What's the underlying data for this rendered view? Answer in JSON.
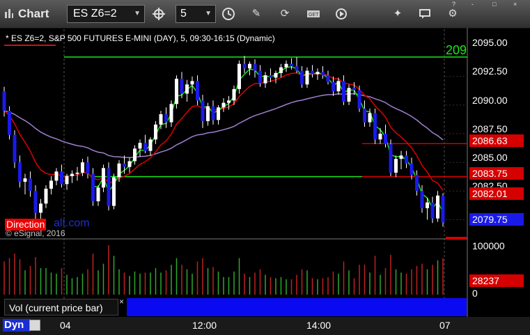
{
  "toolbar": {
    "app_title": "Chart",
    "symbol": "ES Z6=2",
    "interval": "5",
    "window_buttons": [
      "?",
      "-",
      "□",
      "×"
    ],
    "icons": [
      "crosshair-icon",
      "clock-icon",
      "pencil-icon",
      "refresh-icon",
      "get-icon",
      "play-icon",
      "tools-icon",
      "chat-icon",
      "gear-icon"
    ]
  },
  "chart_header": {
    "subtitle": "* ES Z6=2, S&P 500 FUTURES E-MINI (DAY), 5, 09:30-16:15 (Dynamic)",
    "brand_red": "Direction",
    "brand_blue": "alt.com",
    "copyright": "© eSignal, 2016",
    "edge_label": "209"
  },
  "price_axis": {
    "labels": [
      "2095.00",
      "2092.50",
      "2090.00",
      "2087.50",
      "2085.00",
      "2082.50"
    ],
    "tags": [
      {
        "value": "2086.63",
        "color": "#d50000"
      },
      {
        "value": "2083.75",
        "color": "#d50000"
      },
      {
        "value": "2082.01",
        "color": "#d50000"
      },
      {
        "value": "2079.75",
        "color": "#1a1ae8"
      }
    ]
  },
  "volume_axis": {
    "labels": [
      "100000",
      "0"
    ],
    "tag": "28237",
    "tag_color": "#d50000"
  },
  "footer": {
    "dyn": "Dyn",
    "x_ticks": [
      "04",
      "12:00",
      "14:00",
      "07"
    ],
    "vol_label": "Vol (current price bar)",
    "vol_close": "×"
  },
  "chart_data": {
    "type": "candlestick",
    "ylim": [
      2078.5,
      2096.5
    ],
    "horizontal_levels": [
      {
        "value": 2094.2,
        "color": "#19e619"
      },
      {
        "value": 2086.63,
        "color": "#d50000"
      },
      {
        "value": 2083.75,
        "color": "#d50000"
      }
    ],
    "candles": [
      [
        2091.2,
        2091.6,
        2089.0,
        2089.5
      ],
      [
        2089.5,
        2089.9,
        2087.0,
        2087.4
      ],
      [
        2087.4,
        2087.8,
        2084.5,
        2085.0
      ],
      [
        2085.0,
        2085.6,
        2082.8,
        2083.3
      ],
      [
        2083.3,
        2084.0,
        2082.2,
        2083.6
      ],
      [
        2083.6,
        2084.2,
        2082.0,
        2082.5
      ],
      [
        2082.5,
        2083.0,
        2080.0,
        2080.6
      ],
      [
        2080.6,
        2081.8,
        2079.8,
        2081.4
      ],
      [
        2081.4,
        2083.0,
        2081.0,
        2082.7
      ],
      [
        2082.7,
        2083.8,
        2082.2,
        2083.4
      ],
      [
        2083.4,
        2084.5,
        2083.0,
        2084.2
      ],
      [
        2084.2,
        2084.8,
        2082.8,
        2083.1
      ],
      [
        2083.1,
        2084.0,
        2082.6,
        2083.8
      ],
      [
        2083.8,
        2084.3,
        2083.2,
        2084.0
      ],
      [
        2084.0,
        2084.6,
        2083.4,
        2084.1
      ],
      [
        2084.1,
        2085.3,
        2083.8,
        2085.0
      ],
      [
        2085.0,
        2085.5,
        2083.6,
        2084.0
      ],
      [
        2084.0,
        2084.5,
        2081.2,
        2081.6
      ],
      [
        2081.6,
        2083.0,
        2081.2,
        2082.8
      ],
      [
        2082.8,
        2084.8,
        2082.4,
        2084.5
      ],
      [
        2084.5,
        2085.0,
        2080.8,
        2081.2
      ],
      [
        2081.2,
        2084.0,
        2080.9,
        2083.7
      ],
      [
        2083.7,
        2085.2,
        2083.3,
        2084.9
      ],
      [
        2084.9,
        2085.6,
        2084.0,
        2084.6
      ],
      [
        2084.6,
        2085.4,
        2084.1,
        2085.1
      ],
      [
        2085.1,
        2086.5,
        2084.8,
        2086.2
      ],
      [
        2086.2,
        2087.0,
        2085.5,
        2086.7
      ],
      [
        2086.7,
        2087.4,
        2085.8,
        2086.0
      ],
      [
        2086.0,
        2087.2,
        2085.6,
        2087.0
      ],
      [
        2087.0,
        2088.6,
        2086.6,
        2088.3
      ],
      [
        2088.3,
        2089.5,
        2087.9,
        2089.2
      ],
      [
        2089.2,
        2089.8,
        2088.0,
        2088.5
      ],
      [
        2088.5,
        2090.4,
        2088.1,
        2090.1
      ],
      [
        2090.1,
        2092.6,
        2089.7,
        2092.3
      ],
      [
        2092.3,
        2092.9,
        2090.6,
        2091.0
      ],
      [
        2091.0,
        2092.2,
        2090.3,
        2091.8
      ],
      [
        2091.8,
        2092.5,
        2091.0,
        2092.1
      ],
      [
        2092.1,
        2092.6,
        2090.0,
        2090.4
      ],
      [
        2090.4,
        2090.9,
        2088.0,
        2088.6
      ],
      [
        2088.6,
        2090.2,
        2088.2,
        2089.9
      ],
      [
        2089.9,
        2090.4,
        2088.3,
        2088.7
      ],
      [
        2088.7,
        2090.0,
        2088.3,
        2089.8
      ],
      [
        2089.8,
        2090.6,
        2089.4,
        2090.2
      ],
      [
        2090.2,
        2090.8,
        2089.6,
        2090.4
      ],
      [
        2090.4,
        2091.7,
        2090.0,
        2091.4
      ],
      [
        2091.4,
        2093.9,
        2091.0,
        2093.6
      ],
      [
        2093.6,
        2094.3,
        2092.8,
        2093.2
      ],
      [
        2093.2,
        2093.8,
        2092.6,
        2093.6
      ],
      [
        2093.6,
        2094.0,
        2092.4,
        2093.0
      ],
      [
        2093.0,
        2093.5,
        2091.6,
        2091.9
      ],
      [
        2091.9,
        2092.9,
        2091.5,
        2092.6
      ],
      [
        2092.6,
        2093.2,
        2092.0,
        2092.4
      ],
      [
        2092.4,
        2093.0,
        2091.9,
        2092.8
      ],
      [
        2092.8,
        2093.6,
        2092.4,
        2093.3
      ],
      [
        2093.3,
        2093.9,
        2092.9,
        2093.6
      ],
      [
        2093.6,
        2094.1,
        2093.1,
        2093.4
      ],
      [
        2093.4,
        2094.2,
        2092.8,
        2093.0
      ],
      [
        2093.0,
        2093.4,
        2091.5,
        2091.8
      ],
      [
        2091.8,
        2093.3,
        2091.5,
        2093.0
      ],
      [
        2093.0,
        2093.5,
        2092.4,
        2092.7
      ],
      [
        2092.7,
        2093.2,
        2092.2,
        2092.9
      ],
      [
        2092.9,
        2093.4,
        2092.3,
        2092.6
      ],
      [
        2092.6,
        2093.0,
        2091.8,
        2092.0
      ],
      [
        2092.0,
        2092.5,
        2090.8,
        2091.2
      ],
      [
        2091.2,
        2092.4,
        2090.9,
        2092.1
      ],
      [
        2092.1,
        2092.6,
        2090.0,
        2090.3
      ],
      [
        2090.3,
        2091.8,
        2090.0,
        2091.5
      ],
      [
        2091.5,
        2092.0,
        2090.9,
        2091.3
      ],
      [
        2091.3,
        2091.7,
        2089.4,
        2089.7
      ],
      [
        2089.7,
        2090.4,
        2088.1,
        2088.5
      ],
      [
        2088.5,
        2089.7,
        2088.1,
        2089.3
      ],
      [
        2089.3,
        2089.7,
        2086.6,
        2087.0
      ],
      [
        2087.0,
        2088.0,
        2086.6,
        2087.5
      ],
      [
        2087.5,
        2088.3,
        2086.3,
        2086.6
      ],
      [
        2086.6,
        2087.0,
        2083.8,
        2084.1
      ],
      [
        2084.1,
        2085.6,
        2083.7,
        2085.3
      ],
      [
        2085.3,
        2086.0,
        2084.4,
        2085.6
      ],
      [
        2085.6,
        2086.0,
        2084.5,
        2084.9
      ],
      [
        2084.9,
        2085.4,
        2083.5,
        2083.9
      ],
      [
        2083.9,
        2084.3,
        2082.1,
        2082.5
      ],
      [
        2082.5,
        2083.0,
        2080.6,
        2081.0
      ],
      [
        2081.0,
        2081.9,
        2080.0,
        2081.5
      ],
      [
        2081.5,
        2082.0,
        2079.7,
        2080.1
      ],
      [
        2080.1,
        2082.5,
        2079.8,
        2082.1
      ],
      [
        2082.1,
        2082.3,
        2079.4,
        2079.75
      ]
    ]
  }
}
